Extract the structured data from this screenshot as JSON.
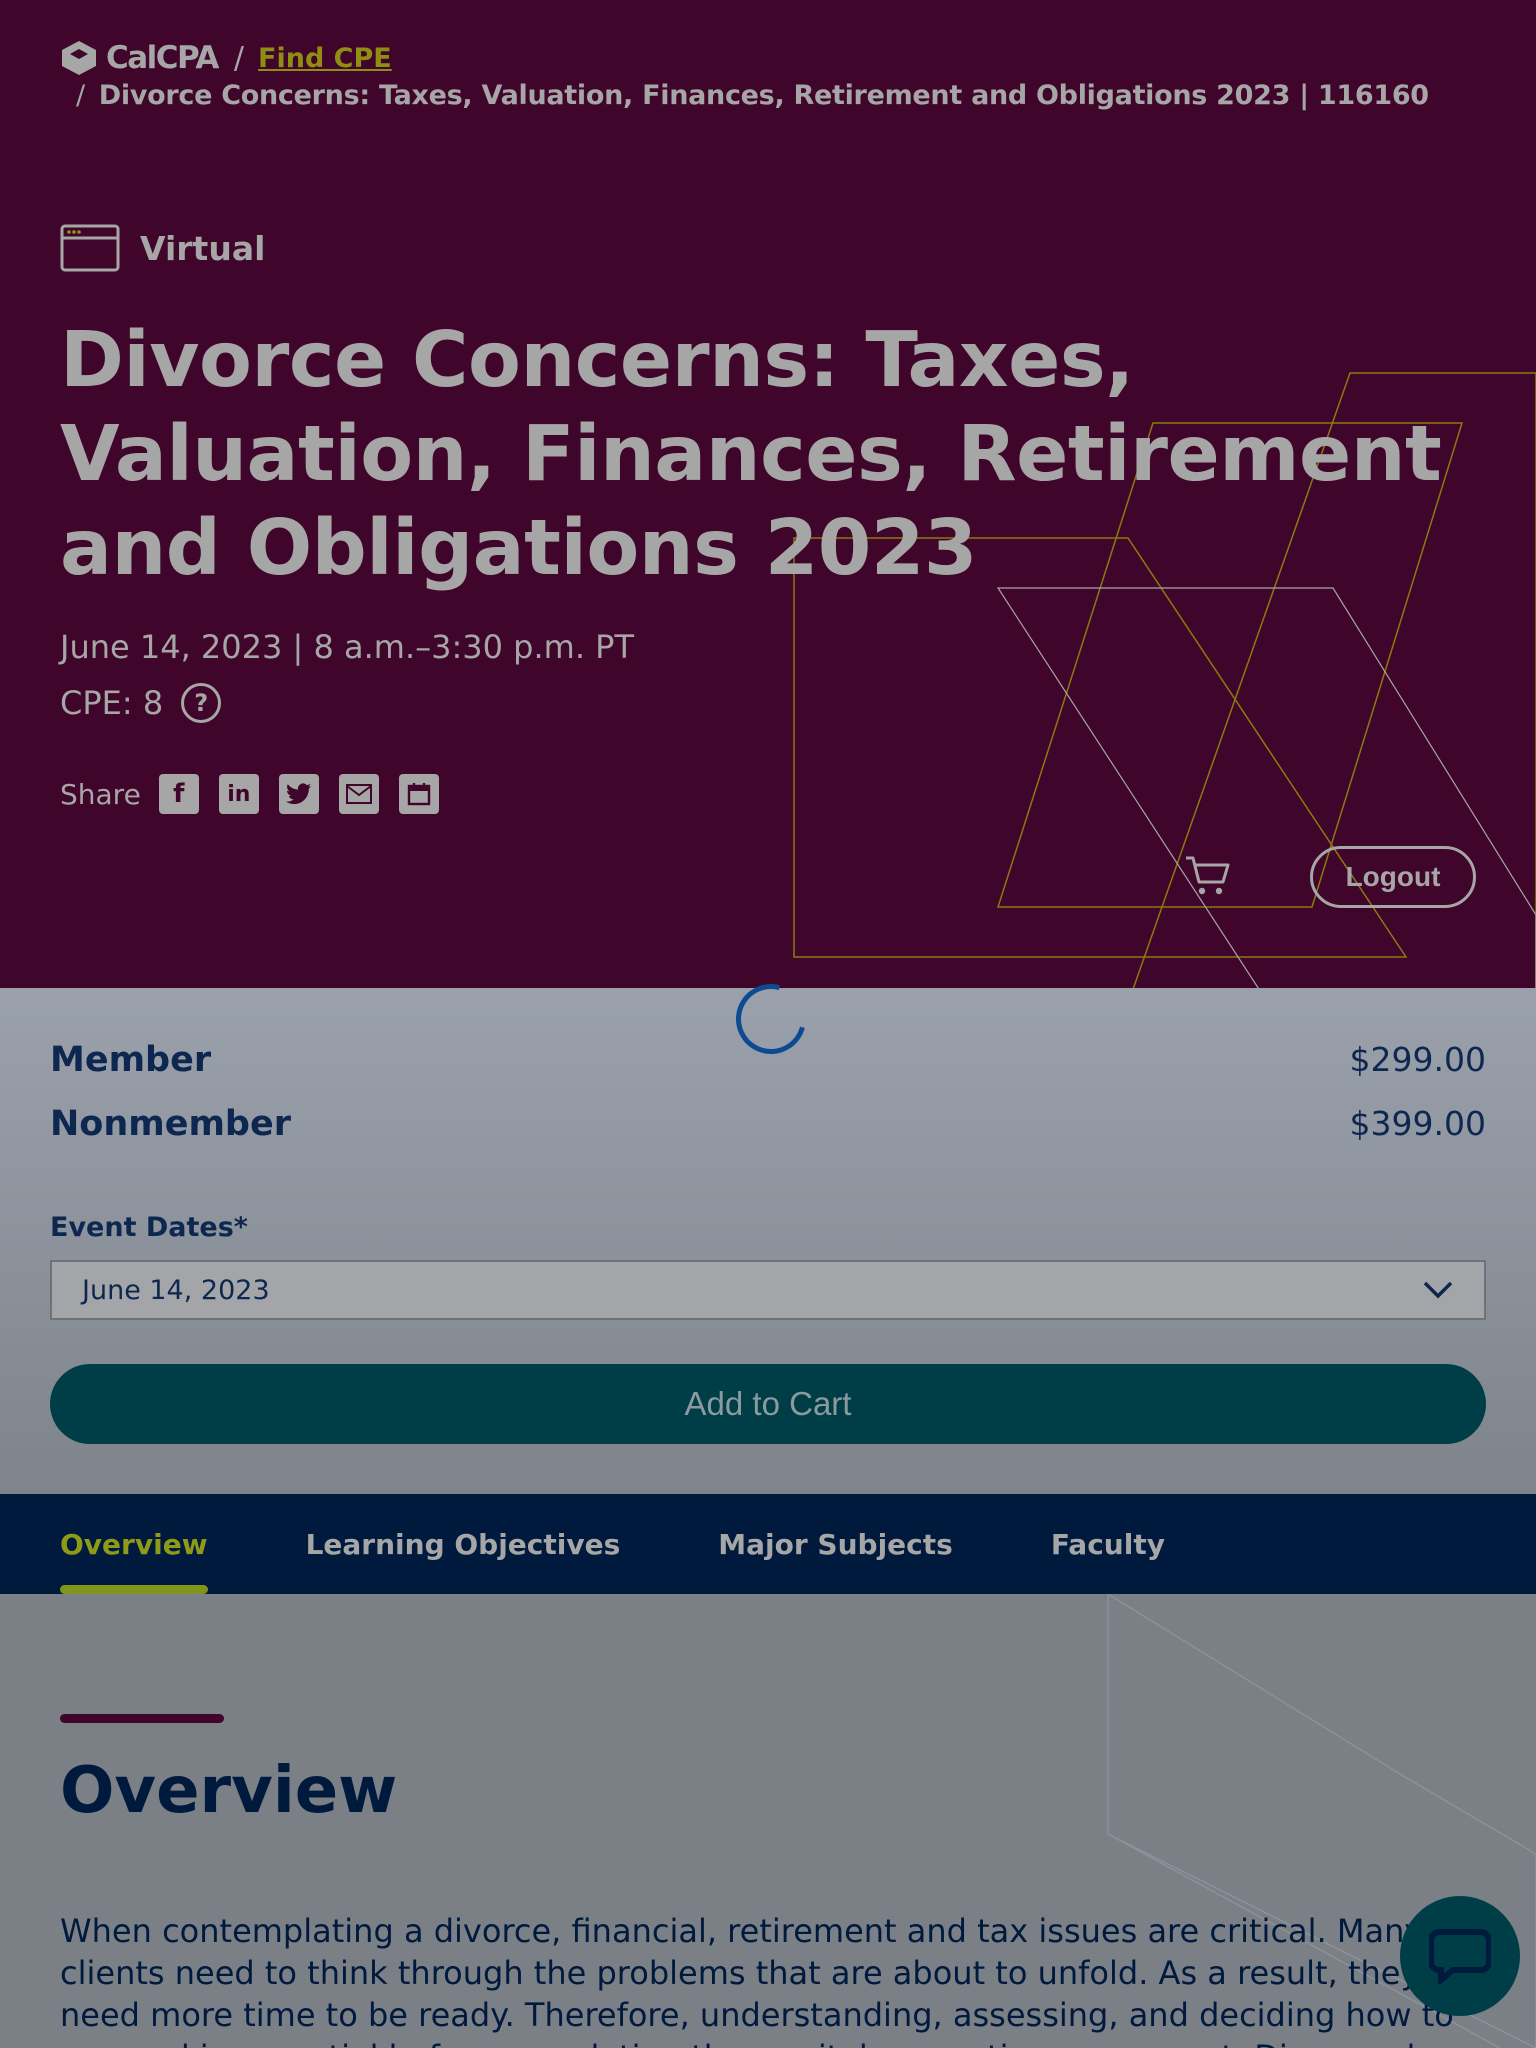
{
  "breadcrumb": {
    "brand": "CalCPA",
    "separator": "/",
    "link": "Find CPE",
    "current": "Divorce Concerns: Taxes, Valuation, Finances, Retirement and Obligations 2023 | 116160"
  },
  "event": {
    "format": "Virtual",
    "title": "Divorce Concerns: Taxes, Valuation, Finances, Retirement and Obligations 2023",
    "datetime": "June 14, 2023 | 8 a.m.–3:30 p.m. PT",
    "cpe": "CPE: 8",
    "help": "?",
    "share_label": "Share"
  },
  "header_actions": {
    "logout": "Logout"
  },
  "pricing": {
    "rows": [
      {
        "label": "Member",
        "price": "$299.00"
      },
      {
        "label": "Nonmember",
        "price": "$399.00"
      }
    ],
    "dates_label": "Event Dates*",
    "selected_date": "June 14, 2023",
    "add_to_cart": "Add to Cart"
  },
  "tabs": [
    {
      "label": "Overview",
      "active": true
    },
    {
      "label": "Learning Objectives",
      "active": false
    },
    {
      "label": "Major Subjects",
      "active": false
    },
    {
      "label": "Faculty",
      "active": false
    }
  ],
  "overview": {
    "heading": "Overview",
    "body": "When contemplating a divorce, financial, retirement and tax issues are critical. Many clients need to think through the problems that are about to unfold. As a result, they need more time to be ready. Therefore, understanding, assessing, and deciding how to proceed is essential before completing the marital separation agreement. Divorce pla"
  },
  "colors": {
    "hero_bg": "#40052a",
    "accent_green": "#8e9a18",
    "navy": "#001a3e",
    "teal": "#003e47"
  },
  "icons": [
    "calcpa-logo-icon",
    "virtual-screen-icon",
    "help-icon",
    "facebook-icon",
    "linkedin-icon",
    "twitter-icon",
    "email-icon",
    "calendar-icon",
    "cart-icon",
    "chevron-down-icon",
    "loading-spinner-icon",
    "chat-icon"
  ]
}
